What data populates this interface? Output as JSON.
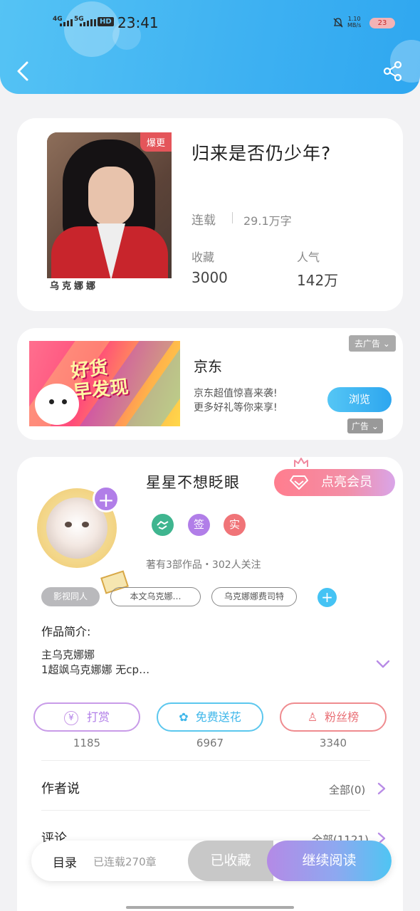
{
  "status_bar": {
    "signal_1": "4G",
    "signal_2": "5G",
    "hd": "HD",
    "time": "23:41",
    "speed_value": "1.10",
    "speed_unit": "MB/s",
    "battery": "23"
  },
  "colors": {
    "header_blue": "#3fb2f2",
    "accent_purple": "#b17ee8",
    "accent_cyan": "#45c3f4",
    "accent_red": "#e4555a"
  },
  "book": {
    "badge": "爆更",
    "cover_caption": "乌克娜娜",
    "title": "归来是否仍少年?",
    "status": "连载",
    "words": "29.1万字",
    "favorites_label": "收藏",
    "favorites_value": "3000",
    "popularity_label": "人气",
    "popularity_value": "142万"
  },
  "ad": {
    "image_text_1": "好货",
    "image_text_2": "早发现",
    "remove_label": "去广告",
    "brand": "京东",
    "desc_line1": "京东超值惊喜来袭!",
    "desc_line2": "更多好礼等你来享!",
    "browse_label": "浏览",
    "ad_label": "广告"
  },
  "author": {
    "name": "星星不想眨眼",
    "vip_label": "点亮会员",
    "badge_sign": "签",
    "badge_real": "实",
    "works_info": "著有3部作品・302人关注",
    "tags": [
      "影视同人",
      "本文乌克娜…",
      "乌克娜娜费司特"
    ],
    "intro_title": "作品简介:",
    "intro_line1": "主乌克娜娜",
    "intro_line2": "1超飒乌克娜娜 无cp…"
  },
  "actions": {
    "reward_label": "打赏",
    "reward_count": "1185",
    "flower_label": "免费送花",
    "flower_count": "6967",
    "fans_label": "粉丝榜",
    "fans_count": "3340"
  },
  "author_says": {
    "title": "作者说",
    "all_label": "全部(0)"
  },
  "comments": {
    "title": "评论",
    "all_label": "全部(1121)"
  },
  "bottom_bar": {
    "toc_label": "目录",
    "chapters_label": "已连载270章",
    "collected_label": "已收藏",
    "continue_label": "继续阅读"
  }
}
